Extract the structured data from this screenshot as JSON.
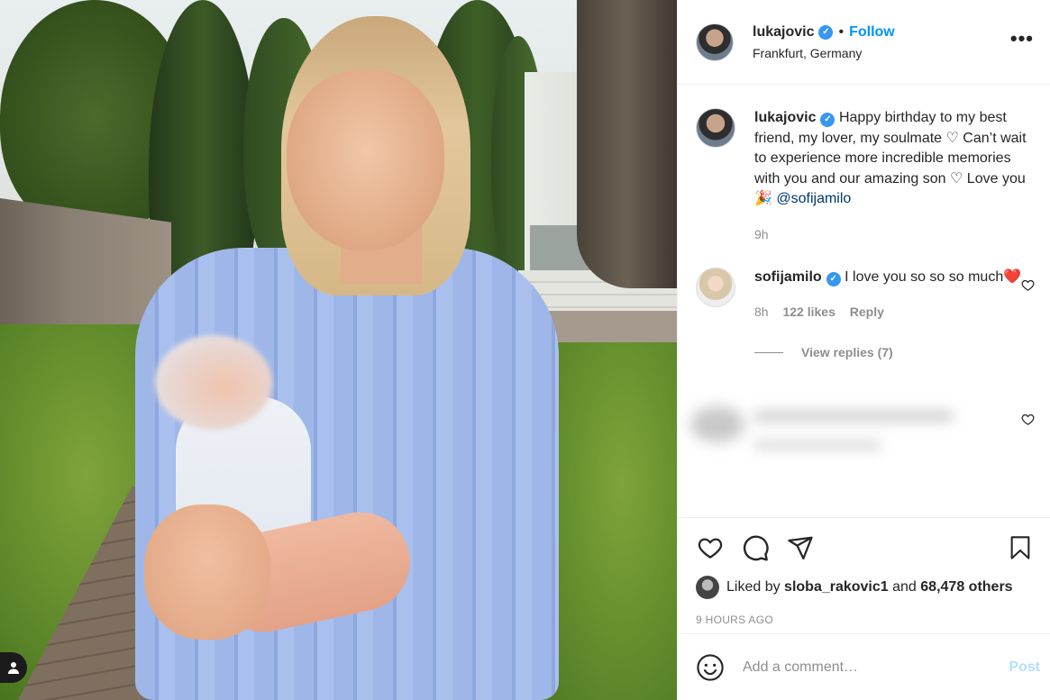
{
  "post": {
    "author": "lukajovic",
    "follow_label": "Follow",
    "location": "Frankfurt, Germany",
    "more_label": "•••",
    "caption": {
      "username": "lukajovic",
      "text": "Happy birthday to my best friend, my lover, my soulmate ♡ Can’t wait to experience more incredible memories with you and our amazing son ♡ Love you 🎉",
      "mention": "@sofijamilo",
      "time": "9h"
    },
    "comments": [
      {
        "username": "sofijamilo",
        "text": "I love you so so so much❤️",
        "time": "8h",
        "likes": "122 likes",
        "reply_label": "Reply",
        "view_replies": "View replies (7)"
      }
    ],
    "liked_by": {
      "prefix": "Liked by",
      "user": "sloba_rakovic1",
      "and": "and",
      "others": "68,478 others"
    },
    "timestamp": "9 HOURS AGO",
    "add_comment": {
      "placeholder": "Add a comment…",
      "post_label": "Post"
    },
    "icons": [
      "heart-icon",
      "comment-icon",
      "share-icon",
      "bookmark-icon",
      "emoji-icon",
      "user-tag-icon"
    ]
  }
}
